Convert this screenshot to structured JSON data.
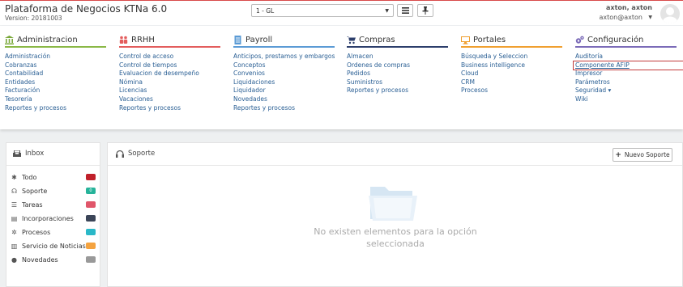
{
  "header": {
    "app_title": "Plataforma de Negocios KTNa 6.0",
    "version": "Version: 20181003",
    "company_select": {
      "value": "1 - GL"
    },
    "list_button_icon": "list-icon",
    "pin_button_icon": "pin-icon",
    "user": {
      "name": "axton, axton",
      "email": "axton@axton"
    }
  },
  "menu": {
    "columns": [
      {
        "title": "Administracion",
        "icon": "bank-icon",
        "color": "#8ab846",
        "items": [
          "Administración",
          "Cobranzas",
          "Contabilidad",
          "Entidades",
          "Facturación",
          "Tesorería",
          "Reportes y procesos"
        ]
      },
      {
        "title": "RRHH",
        "icon": "people-icon",
        "color": "#e35d5d",
        "items": [
          "Control de acceso",
          "Control de tiempos",
          "Evaluacion de desempeño",
          "Nómina",
          "Licencias",
          "Vacaciones",
          "Reportes y procesos"
        ]
      },
      {
        "title": "Payroll",
        "icon": "document-icon",
        "color": "#5b9bd5",
        "items": [
          "Anticipos, prestamos y embargos",
          "Conceptos",
          "Convenios",
          "Liquidaciones",
          "Liquidador",
          "Novedades",
          "Reportes y procesos"
        ]
      },
      {
        "title": "Compras",
        "icon": "cart-icon",
        "color": "#2c3e6b",
        "items": [
          "Almacen",
          "Ordenes de compras",
          "Pedidos",
          "Suministros",
          "Reportes y procesos"
        ]
      },
      {
        "title": "Portales",
        "icon": "monitor-icon",
        "color": "#f0a030",
        "items": [
          "Búsqueda y Seleccion",
          "Business intelligence",
          "Cloud",
          "CRM",
          "Procesos"
        ]
      },
      {
        "title": "Configuración",
        "icon": "gears-icon",
        "color": "#7b6bb8",
        "items": [
          "Auditoría",
          "Componente AFIP",
          "Impresor",
          "Parámetros",
          "Seguridad ▾",
          "Wiki"
        ]
      }
    ],
    "selected_item": "Componente AFIP"
  },
  "inbox": {
    "title": "Inbox",
    "items": [
      {
        "label": "Todo",
        "icon": "asterisk-icon",
        "badge": "",
        "color": "#c0202a"
      },
      {
        "label": "Soporte",
        "icon": "headset-icon",
        "badge": "0",
        "color": "#26b39a"
      },
      {
        "label": "Tareas",
        "icon": "tasks-icon",
        "badge": "",
        "color": "#e0566a"
      },
      {
        "label": "Incorporaciones",
        "icon": "inbox-icon",
        "badge": "",
        "color": "#3b4558"
      },
      {
        "label": "Procesos",
        "icon": "gear-icon",
        "badge": "",
        "color": "#2ab8c8"
      },
      {
        "label": "Servicio de Noticias",
        "icon": "newspaper-icon",
        "badge": "",
        "color": "#f4a340"
      },
      {
        "label": "Novedades",
        "icon": "alert-icon",
        "badge": "",
        "color": "#999999"
      }
    ]
  },
  "support": {
    "title": "Soporte",
    "new_button": "Nuevo Soporte",
    "empty_message": "No existen elementos para la opción seleccionada"
  }
}
